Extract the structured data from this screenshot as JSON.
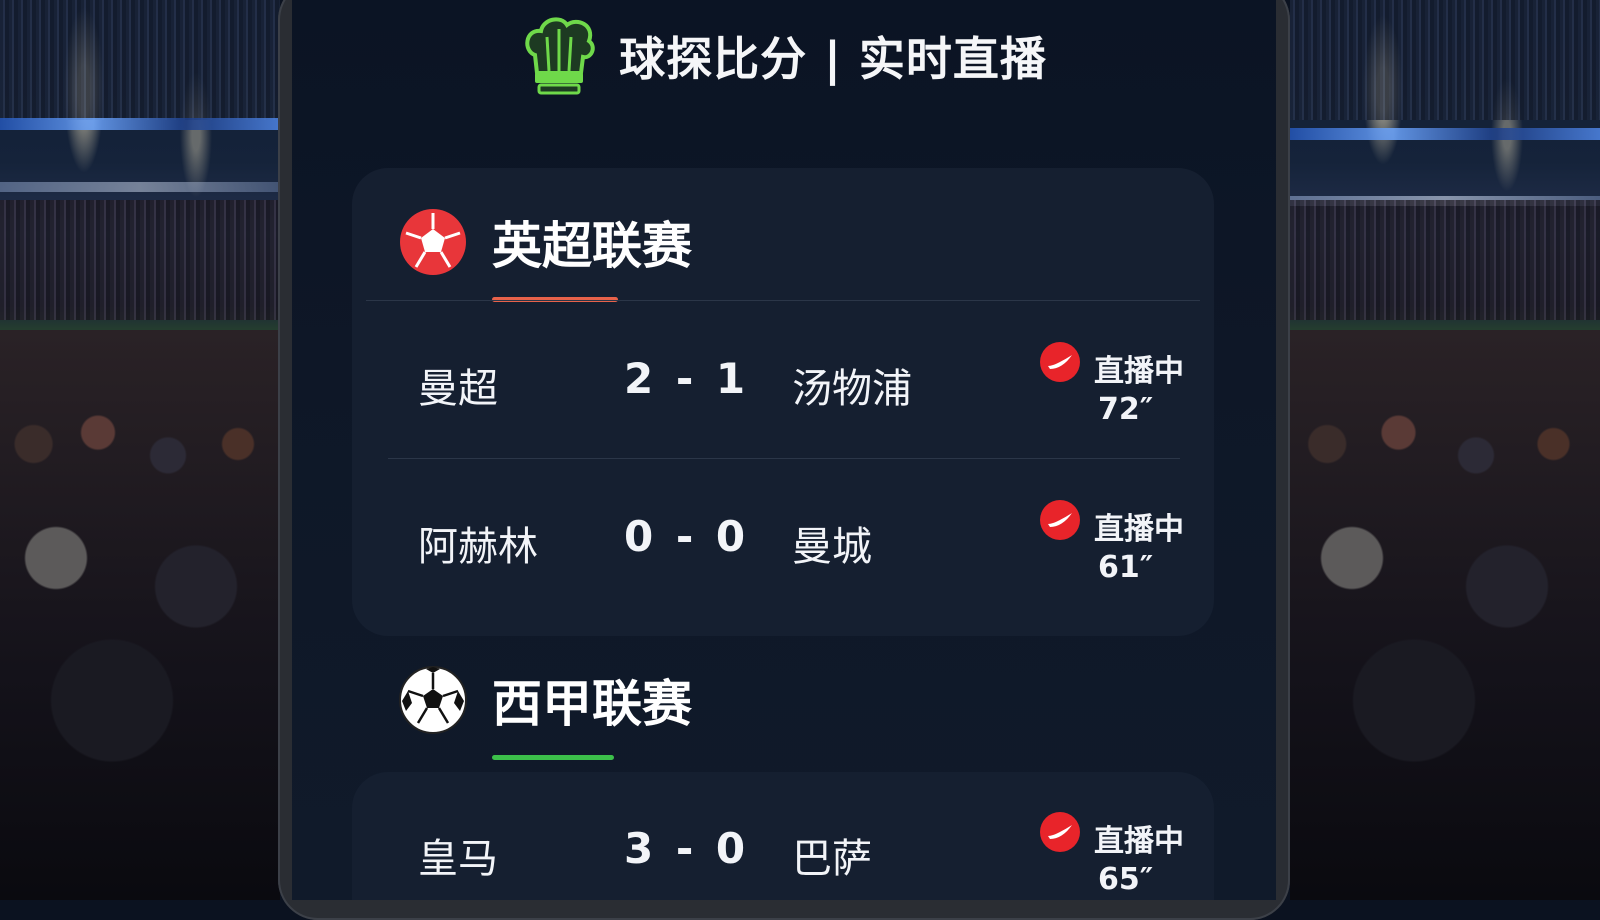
{
  "app": {
    "title": "球探比分 | 实时直播",
    "logo_icon": "chef-hat-icon"
  },
  "leagues": [
    {
      "name": "英超联赛",
      "icon": "red-soccer-ball-icon",
      "accent_color": "#e8624a",
      "matches": [
        {
          "home": "曼超",
          "score": "2 - 1",
          "away": "汤物浦",
          "status": "直播中",
          "minute": "72″"
        },
        {
          "home": "阿赫林",
          "score": "0 - 0",
          "away": "曼城",
          "status": "直播中",
          "minute": "61″"
        }
      ]
    },
    {
      "name": "西甲联赛",
      "icon": "soccer-ball-icon",
      "accent_color": "#3cc04a",
      "matches": [
        {
          "home": "皇马",
          "score": "3 - 0",
          "away": "巴萨",
          "status": "直播中",
          "minute": "65″"
        }
      ]
    }
  ],
  "colors": {
    "background": "#0b1220",
    "card": "#151f30",
    "live_red": "#e8242a",
    "logo_green": "#6fd94a"
  }
}
